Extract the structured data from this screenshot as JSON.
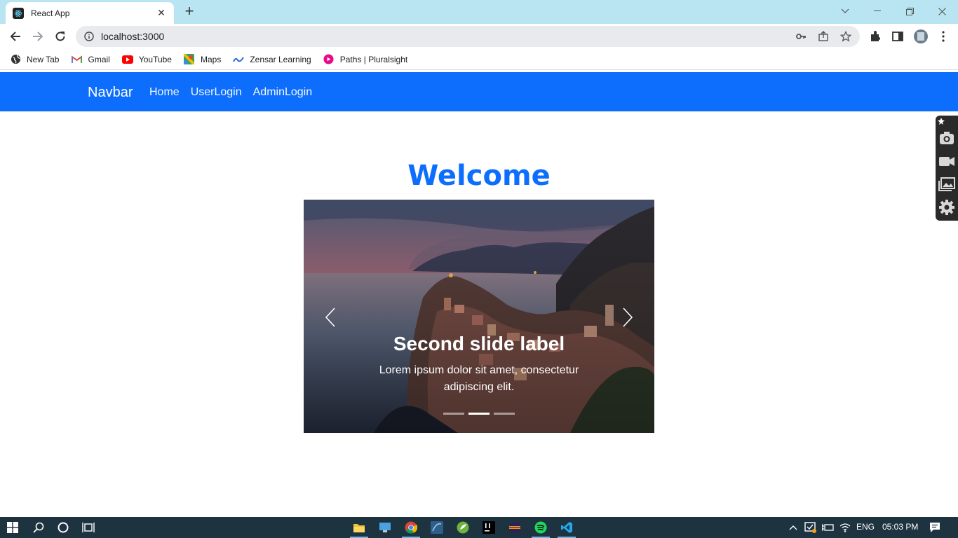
{
  "browser": {
    "tab_title": "React App",
    "url": "localhost:3000",
    "bookmarks": [
      {
        "label": "New Tab",
        "icon": "globe-icon"
      },
      {
        "label": "Gmail",
        "icon": "gmail-icon"
      },
      {
        "label": "YouTube",
        "icon": "youtube-icon"
      },
      {
        "label": "Maps",
        "icon": "maps-icon"
      },
      {
        "label": "Zensar Learning",
        "icon": "zensar-icon"
      },
      {
        "label": "Paths | Pluralsight",
        "icon": "pluralsight-icon"
      }
    ]
  },
  "navbar": {
    "brand": "Navbar",
    "links": [
      "Home",
      "UserLogin",
      "AdminLogin"
    ],
    "color": "#0d6efd"
  },
  "main": {
    "heading": "Welcome",
    "carousel": {
      "caption_title": "Second slide label",
      "caption_text": "Lorem ipsum dolor sit amet, consectetur adipiscing elit.",
      "slide_count": 3,
      "active_index": 1
    }
  },
  "side_tools": [
    "camera-icon",
    "video-icon",
    "gallery-icon",
    "settings-icon"
  ],
  "taskbar": {
    "language": "ENG",
    "time": "05:03 PM"
  }
}
